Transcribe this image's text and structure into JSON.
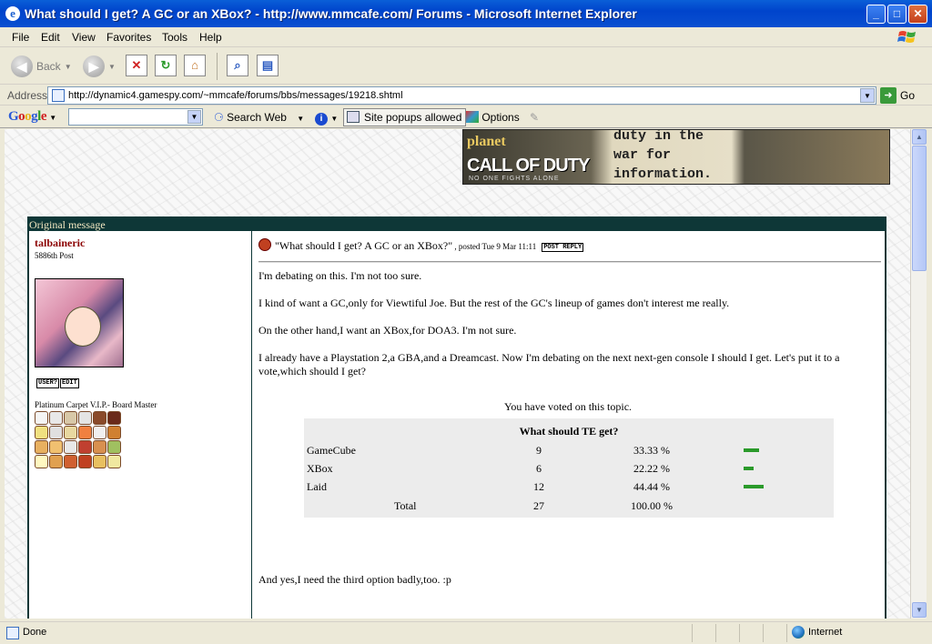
{
  "window": {
    "title": "What should I get? A GC or an XBox? - http://www.mmcafe.com/ Forums - Microsoft Internet Explorer",
    "minimize": "_",
    "maximize": "□",
    "close": "✕"
  },
  "menu": [
    "File",
    "Edit",
    "View",
    "Favorites",
    "Tools",
    "Help"
  ],
  "toolbar": {
    "back_label": "Back",
    "icons": [
      "back-icon",
      "forward-icon",
      "stop-icon",
      "refresh-icon",
      "home-icon",
      "search-icon",
      "media-icon"
    ]
  },
  "address": {
    "label": "Address",
    "url": "http://dynamic4.gamespy.com/~mmcafe/forums/bbs/messages/19218.shtml",
    "go_label": "Go"
  },
  "googlebar": {
    "logo": "Google",
    "search_value": "",
    "search_web": "Search Web",
    "popups": "Site popups allowed",
    "options": "Options"
  },
  "banner": {
    "planet": "planet",
    "logo": "CALL OF DUTY",
    "slogan": "NO ONE FIGHTS ALONE",
    "text": "duty in the\nwar for\ninformation."
  },
  "message": {
    "header": "Original message",
    "author": "talbaineric",
    "post_count": "5886th Post",
    "user_btn": "USER?",
    "edit_btn": "EDIT",
    "user_title": "Platinum Carpet V.I.P.- Board Master",
    "subject": "\"What should I get? A GC or an XBox?\"",
    "posted": " , posted Tue 9 Mar 11:11",
    "reply_btn": "POST REPLY",
    "paragraphs": [
      "I'm debating on this. I'm not too sure.",
      "I kind of want a GC,only for Viewtiful Joe. But the rest of the GC's lineup of games don't interest me really.",
      "On the other hand,I want an XBox,for DOA3. I'm not sure.",
      "I already have a Playstation 2,a GBA,and a Dreamcast. Now I'm debating on the next next-gen console I should I get. Let's put it to a vote,which should I get?"
    ],
    "voted_note": "You have voted on this topic.",
    "footer": "And yes,I need the third option badly,too. :p"
  },
  "poll": {
    "title": "What should TE get?",
    "options": [
      {
        "label": "GameCube",
        "votes": "9",
        "percent": "33.33 %",
        "fraction": 0.3333
      },
      {
        "label": "XBox",
        "votes": "6",
        "percent": "22.22 %",
        "fraction": 0.2222
      },
      {
        "label": "Laid",
        "votes": "12",
        "percent": "44.44 %",
        "fraction": 0.4444
      }
    ],
    "total_label": "Total",
    "total_votes": "27",
    "total_percent": "100.00 %"
  },
  "status": {
    "text": "Done",
    "zone": "Internet"
  }
}
